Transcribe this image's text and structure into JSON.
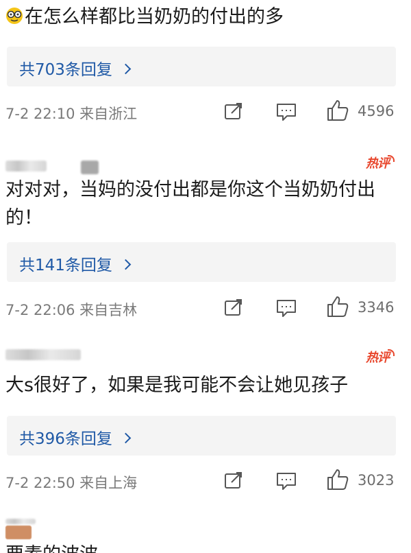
{
  "comments": [
    {
      "text": "在怎么样都比当奶奶的付出的多",
      "replies": "共703条回复",
      "meta": "7-2 22:10 来自浙江",
      "likes": "4596",
      "hot": ""
    },
    {
      "hot": "热评",
      "text": "对对对，当妈的没付出都是你这个当奶奶付出的！",
      "replies": "共141条回复",
      "meta": "7-2 22:06 来自吉林",
      "likes": "3346"
    },
    {
      "hot": "热评",
      "text": "大s很好了，如果是我可能不会让她见孩子",
      "replies": "共396条回复",
      "meta": "7-2 22:50 来自上海",
      "likes": "3023"
    },
    {
      "text": "要素的波波"
    }
  ],
  "icons": {
    "emoji": "grimace-emoji-icon",
    "share": "share-icon",
    "comment": "comment-icon",
    "like": "thumbs-up-icon",
    "reply_arrow": "chevron-right-icon"
  },
  "colors": {
    "link": "#1f59a6",
    "hot": "#e8462c",
    "meta": "#7a7a7a"
  }
}
